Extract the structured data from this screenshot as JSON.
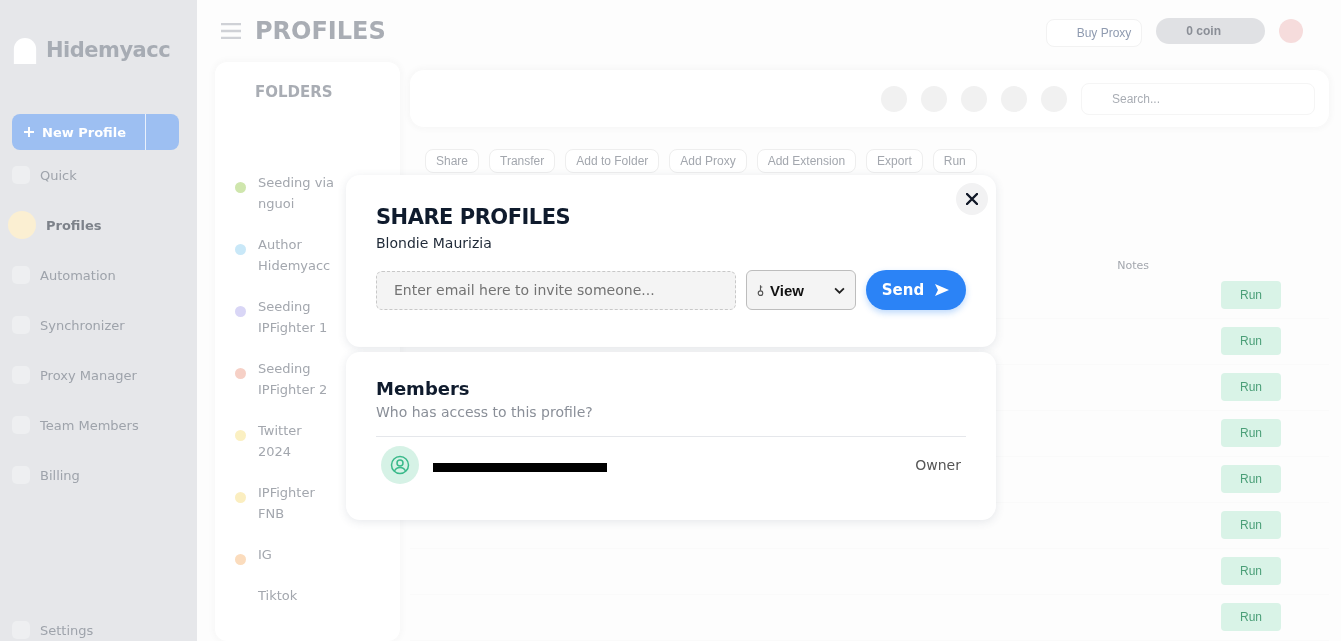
{
  "sidebar": {
    "logo": "Hidemyacc",
    "new_profile": "New Profile",
    "items": [
      {
        "label": "Quick",
        "selected": false
      },
      {
        "label": "Profiles",
        "selected": true
      },
      {
        "label": "Automation",
        "selected": false
      },
      {
        "label": "Synchronizer",
        "selected": false
      },
      {
        "label": "Proxy Manager",
        "selected": false
      },
      {
        "label": "Team Members",
        "selected": false
      },
      {
        "label": "Billing",
        "selected": false
      }
    ],
    "settings": "Settings"
  },
  "header": {
    "title": "PROFILES",
    "buy_proxy": "Buy Proxy",
    "coin": "0 coin"
  },
  "folders": {
    "title": "FOLDERS",
    "items": [
      {
        "name": "Seeding via nguoi",
        "color": "#cfe6ad"
      },
      {
        "name": "Author Hidemyacc",
        "color": "#c9e8f8"
      },
      {
        "name": "Seeding IPFighter 1",
        "color": "#d9d6f6"
      },
      {
        "name": "Seeding IPFighter 2",
        "color": "#f6d0c6"
      },
      {
        "name": "Twitter 2024",
        "color": "#fbf0c2"
      },
      {
        "name": "IPFighter FNB",
        "color": "#fbeec0"
      },
      {
        "name": "IG",
        "color": "#fbdcbd"
      },
      {
        "name": "Tiktok"
      }
    ]
  },
  "toolbar": {
    "search_placeholder": "Search...",
    "actions": [
      "Share",
      "Transfer",
      "Add to Folder",
      "Add Proxy",
      "Add Extension",
      "Export",
      "Run"
    ]
  },
  "table": {
    "columns": [
      "Notes"
    ],
    "rows": [
      {
        "action": "Run"
      },
      {
        "action": "Run"
      },
      {
        "action": "Run"
      },
      {
        "action": "Run"
      },
      {
        "action": "Run"
      },
      {
        "action": "Run"
      },
      {
        "action": "Run"
      },
      {
        "action": "Run"
      }
    ]
  },
  "dialog": {
    "title": "SHARE PROFILES",
    "subtitle": "Blondie Maurizia",
    "email_placeholder": "Enter email here to invite someone...",
    "permission": "View",
    "send": "Send",
    "members_title": "Members",
    "members_subtitle": "Who has access to this profile?",
    "members": [
      {
        "role": "Owner"
      }
    ]
  }
}
